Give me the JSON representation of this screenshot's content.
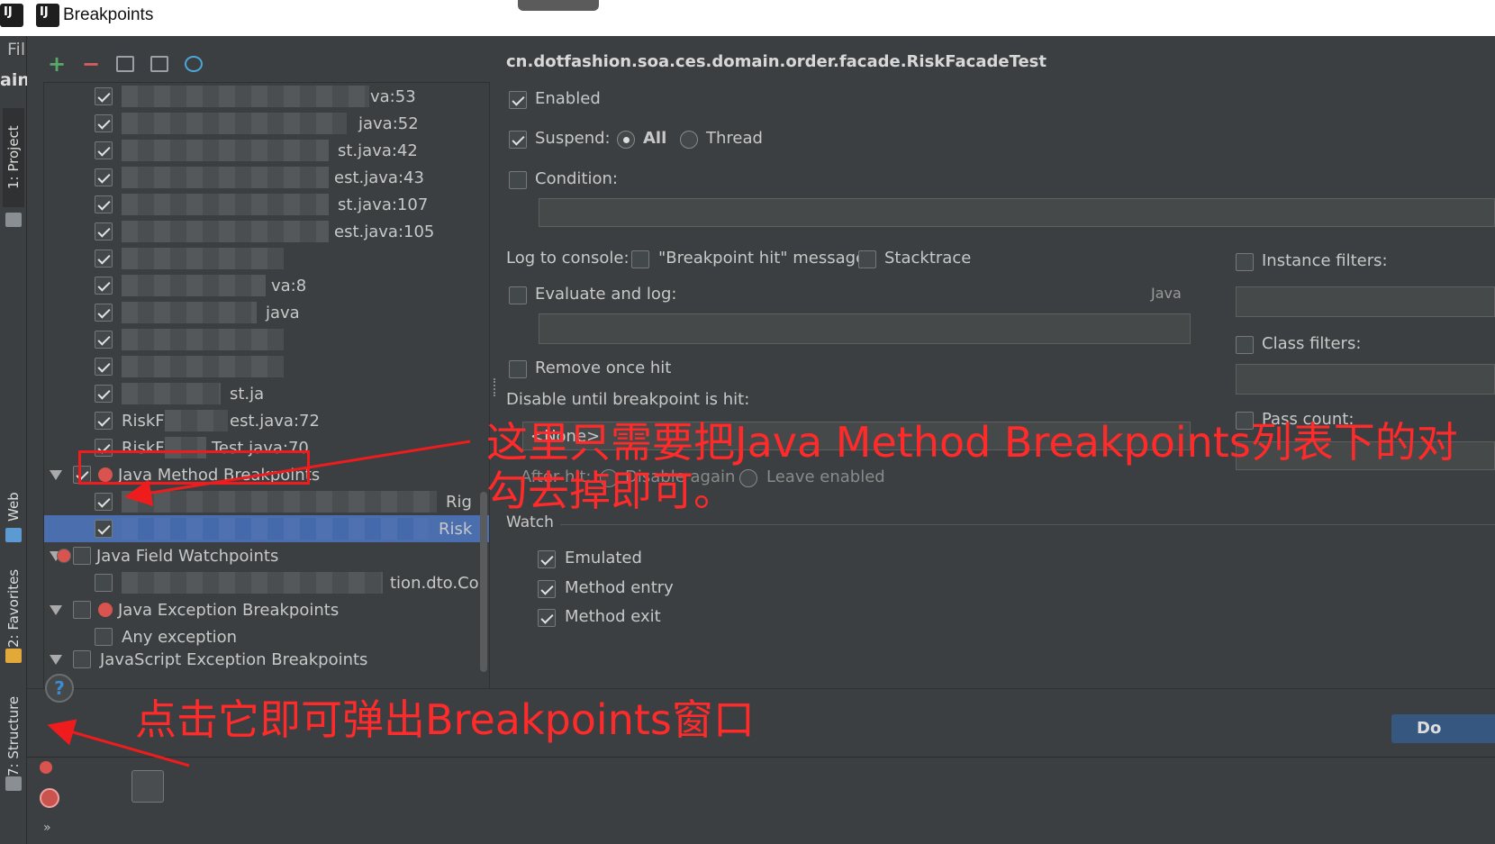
{
  "window": {
    "title": "Breakpoints"
  },
  "ide": {
    "menu_fragment": "Fil",
    "main_fragment": "ain",
    "side_tabs": [
      {
        "label": "1: Project"
      },
      {
        "label": "Web"
      },
      {
        "label": "2: Favorites"
      },
      {
        "label": "7: Structure"
      }
    ]
  },
  "tree": {
    "rows": [
      {
        "label": "va:53",
        "checked": true
      },
      {
        "label": "java:52",
        "checked": true
      },
      {
        "label": "st.java:42",
        "checked": true
      },
      {
        "label": "est.java:43",
        "checked": true
      },
      {
        "label": "st.java:107",
        "checked": true
      },
      {
        "label": "est.java:105",
        "checked": true
      },
      {
        "label": "",
        "checked": true
      },
      {
        "label": "va:8",
        "checked": true
      },
      {
        "label": "java",
        "checked": true
      },
      {
        "label": "",
        "checked": true
      },
      {
        "label": "",
        "checked": true
      },
      {
        "label": "st.ja",
        "checked": true
      },
      {
        "label": "RiskF",
        "label2": "est.java:72",
        "checked": true
      },
      {
        "label": "RiskF",
        "label2": "Test.java:70",
        "checked": true
      }
    ],
    "categories": {
      "method": {
        "label": "Java Method Breakpoints",
        "checked": true
      },
      "method_items": [
        {
          "label": "Rig",
          "checked": true
        },
        {
          "label": "Risk",
          "checked": true,
          "selected": true
        }
      ],
      "field": {
        "label": "Java Field Watchpoints",
        "checked": false
      },
      "field_items": [
        {
          "label": "tion.dto.Co",
          "checked": false
        }
      ],
      "exception": {
        "label": "Java Exception Breakpoints",
        "checked": false
      },
      "exception_items": [
        {
          "label": "Any exception",
          "checked": false
        }
      ],
      "js": {
        "label": "JavaScript Exception Breakpoints"
      }
    }
  },
  "details": {
    "class_name": "cn.dotfashion.soa.ces.domain.order.facade.RiskFacadeTest",
    "enabled": {
      "label": "Enabled",
      "checked": true
    },
    "suspend": {
      "label": "Suspend:",
      "checked": true,
      "options": [
        "All",
        "Thread"
      ],
      "selected": "All"
    },
    "condition": {
      "label": "Condition:",
      "checked": false
    },
    "log_to_console": {
      "label": "Log to console:",
      "message": "\"Breakpoint hit\" message",
      "stacktrace": "Stacktrace"
    },
    "evaluate_and_log": {
      "label": "Evaluate and log:",
      "language": "Java"
    },
    "remove_once_hit": {
      "label": "Remove once hit",
      "checked": false
    },
    "disable_until": {
      "label": "Disable until breakpoint is hit:",
      "value": "<None>"
    },
    "after_hit": {
      "label": "After hit:",
      "options": [
        "Disable again",
        "Leave enabled"
      ]
    },
    "watch": {
      "label": "Watch",
      "items": [
        {
          "label": "Emulated",
          "checked": true
        },
        {
          "label": "Method entry",
          "checked": true
        },
        {
          "label": "Method exit",
          "checked": true
        }
      ]
    },
    "instance_filters": {
      "label": "Instance filters:",
      "checked": false
    },
    "class_filters": {
      "label": "Class filters:",
      "checked": false
    },
    "pass_count": {
      "label": "Pass count:",
      "checked": false
    }
  },
  "buttons": {
    "done": "Do",
    "help": "?"
  },
  "annotations": {
    "method_note_line1": "这里只需要把Java Method Breakpoints列表下的对",
    "method_note_line2": "勾去掉即可。",
    "bottom_note": "点击它即可弹出Breakpoints窗口"
  },
  "colors": {
    "background": "#3c3f41",
    "selection": "#4b6eaf",
    "annotation": "#ee1c1c",
    "done_button": "#365880"
  }
}
